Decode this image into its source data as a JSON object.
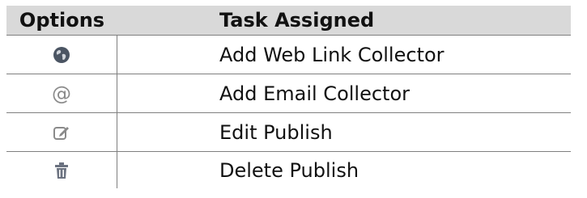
{
  "table": {
    "headers": {
      "options": "Options",
      "task": "Task Assigned"
    },
    "rows": [
      {
        "icon": "globe-icon",
        "task": "Add Web Link Collector"
      },
      {
        "icon": "at-sign-icon",
        "icon_glyph": "@",
        "task": "Add Email Collector"
      },
      {
        "icon": "edit-icon",
        "task": "Edit Publish"
      },
      {
        "icon": "trash-icon",
        "task": "Delete Publish"
      }
    ]
  },
  "colors": {
    "header_background": "#d9d9d9",
    "border": "#7f7f7f",
    "icon_gray": "#8a8a8a",
    "globe_dark": "#4b5563"
  }
}
